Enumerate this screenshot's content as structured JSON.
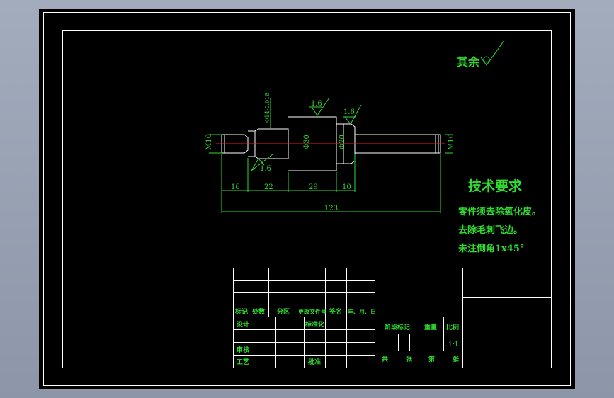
{
  "colors": {
    "background": "#000000",
    "frame": "#ffffff",
    "geometry": "#ffffff",
    "annotation": "#2fdc2f",
    "centerline": "#e02020",
    "viewport": "#9aa4b6"
  },
  "roughness_note": {
    "text": "其余",
    "icon": "roughness-check-icon"
  },
  "technical_requirements": {
    "title": "技术要求",
    "items": [
      "零件须去除氧化皮。",
      "去除毛刺飞边。",
      "未注倒角1x45°"
    ]
  },
  "dimensions": {
    "d_left": "M10",
    "d_shoulder": "Φ14-0.018",
    "d_shoulder_tol": "-0.018",
    "d_body": "Φ30",
    "d_neck": "Φ20",
    "d_right": "M10",
    "l1": "16",
    "l2": "22",
    "l3": "29",
    "l4": "10",
    "total": "123",
    "roughness_top_left": "1.6",
    "roughness_top_right": "1.6",
    "roughness_bottom": "1.6"
  },
  "title_block": {
    "row_marks": "标记",
    "row_count": "处数",
    "row_zone": "分区",
    "row_docno": "更改文件号",
    "row_sign": "签名",
    "row_date": "年、月、日",
    "design": "设计",
    "standardize": "标准化",
    "review": "审核",
    "process": "工艺",
    "approve": "批准",
    "stage_mark": "阶段标记",
    "weight": "重量",
    "scale": "比例",
    "scale_value": "1:1",
    "total_sheets": "共",
    "sheet_word": "张",
    "nth": "第",
    "sheet_word2": "张"
  }
}
